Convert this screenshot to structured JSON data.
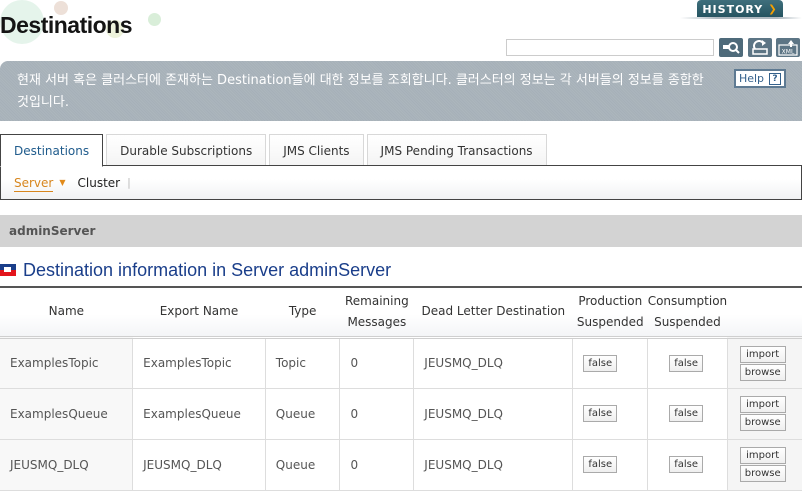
{
  "header": {
    "title": "Destinations",
    "history_label": "HISTORY",
    "search_placeholder": "",
    "search_value": ""
  },
  "description": {
    "text": "현재 서버 혹은 클러스터에 존재하는 Destination들에 대한 정보를 조회합니다. 클러스터의 정보는 각 서버들의 정보를 종합한 것입니다.",
    "help_label": "Help",
    "help_icon_glyph": "?"
  },
  "tabs": [
    {
      "label": "Destinations",
      "active": true
    },
    {
      "label": "Durable Subscriptions",
      "active": false
    },
    {
      "label": "JMS Clients",
      "active": false
    },
    {
      "label": "JMS Pending Transactions",
      "active": false
    }
  ],
  "subnav": {
    "server_label": "Server",
    "cluster_label": "Cluster",
    "separator": "|"
  },
  "server_bar": {
    "label": "adminServer"
  },
  "section": {
    "title": "Destination information in Server adminServer"
  },
  "table": {
    "headers": [
      "Name",
      "Export Name",
      "Type",
      "Remaining\nMessages",
      "Dead Letter Destination",
      "Production\nSuspended",
      "Consumption\nSuspended",
      ""
    ],
    "header_lines": [
      [
        "Name"
      ],
      [
        "Export Name"
      ],
      [
        "Type"
      ],
      [
        "Remaining",
        "Messages"
      ],
      [
        "Dead Letter Destination"
      ],
      [
        "Production",
        "Suspended"
      ],
      [
        "Consumption",
        "Suspended"
      ],
      []
    ],
    "rows": [
      {
        "name": "ExamplesTopic",
        "export_name": "ExamplesTopic",
        "type": "Topic",
        "remaining": "0",
        "dld": "JEUSMQ_DLQ",
        "production": "false",
        "consumption": "false",
        "import": "import",
        "browse": "browse"
      },
      {
        "name": "ExamplesQueue",
        "export_name": "ExamplesQueue",
        "type": "Queue",
        "remaining": "0",
        "dld": "JEUSMQ_DLQ",
        "production": "false",
        "consumption": "false",
        "import": "import",
        "browse": "browse"
      },
      {
        "name": "JEUSMQ_DLQ",
        "export_name": "JEUSMQ_DLQ",
        "type": "Queue",
        "remaining": "0",
        "dld": "JEUSMQ_DLQ",
        "production": "false",
        "consumption": "false",
        "import": "import",
        "browse": "browse"
      }
    ]
  },
  "colors": {
    "accent_blue": "#1a3e8a",
    "tab_active": "#1f5b8c",
    "server_orange": "#d7861e",
    "history_bg": "#2f5f6c",
    "history_chevron": "#f5a000",
    "description_bg": "#a6b0b8"
  }
}
